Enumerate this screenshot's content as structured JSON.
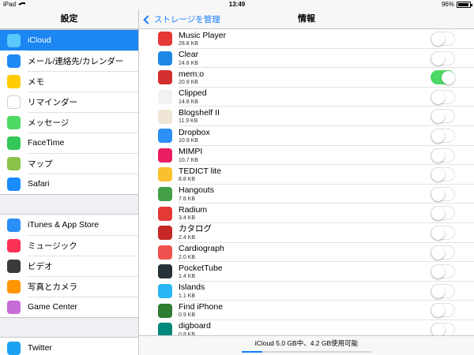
{
  "statusbar": {
    "device": "iPad",
    "time": "13:49",
    "battery": "96%",
    "battery_level": 0.96
  },
  "sidebar": {
    "title": "設定",
    "groups": [
      [
        {
          "label": "iCloud",
          "icon": "icloud-icon",
          "color": "#5ac8fa",
          "selected": true
        },
        {
          "label": "メール/連絡先/カレンダー",
          "icon": "mail-icon",
          "color": "#1e88f5"
        },
        {
          "label": "メモ",
          "icon": "notes-icon",
          "color": "#ffcc00"
        },
        {
          "label": "リマインダー",
          "icon": "reminders-icon",
          "color": "#ffffff"
        },
        {
          "label": "メッセージ",
          "icon": "messages-icon",
          "color": "#4cd964"
        },
        {
          "label": "FaceTime",
          "icon": "facetime-icon",
          "color": "#34c759"
        },
        {
          "label": "マップ",
          "icon": "maps-icon",
          "color": "#8bc34a"
        },
        {
          "label": "Safari",
          "icon": "safari-icon",
          "color": "#1a8cff"
        }
      ],
      [
        {
          "label": "iTunes & App Store",
          "icon": "app-store-icon",
          "color": "#2a8ef7"
        },
        {
          "label": "ミュージック",
          "icon": "music-icon",
          "color": "#fc3158"
        },
        {
          "label": "ビデオ",
          "icon": "video-icon",
          "color": "#3a3a3c"
        },
        {
          "label": "写真とカメラ",
          "icon": "photos-icon",
          "color": "#ff9500"
        },
        {
          "label": "Game Center",
          "icon": "game-center-icon",
          "color": "#c86dd7"
        }
      ],
      [
        {
          "label": "Twitter",
          "icon": "twitter-icon",
          "color": "#1da1f2"
        }
      ]
    ]
  },
  "nav": {
    "back_label": "ストレージを管理",
    "title": "情報"
  },
  "apps": [
    {
      "name": "Music Player",
      "size": "28.8 KB",
      "icon": "music-player-icon",
      "color": "#e53935",
      "on": false
    },
    {
      "name": "Clear",
      "size": "24.8 KB",
      "icon": "clear-icon",
      "color": "#1e88e5",
      "on": false
    },
    {
      "name": "mem:o",
      "size": "20.9 KB",
      "icon": "memo-icon",
      "color": "#d32f2f",
      "on": true
    },
    {
      "name": "Clipped",
      "size": "14.8 KB",
      "icon": "clipped-icon",
      "color": "#f2f2f2",
      "on": false
    },
    {
      "name": "Blogshelf II",
      "size": "11.9 KB",
      "icon": "blogshelf-icon",
      "color": "#efe6d6",
      "on": false
    },
    {
      "name": "Dropbox",
      "size": "10.9 KB",
      "icon": "dropbox-icon",
      "color": "#2b8ff5",
      "on": false
    },
    {
      "name": "MIMPI",
      "size": "10.7 KB",
      "icon": "mimpi-icon",
      "color": "#e91e63",
      "on": false
    },
    {
      "name": "TEDICT lite",
      "size": "8.8 KB",
      "icon": "tedict-icon",
      "color": "#fbc02d",
      "on": false
    },
    {
      "name": "Hangouts",
      "size": "7.8 KB",
      "icon": "hangouts-icon",
      "color": "#43a047",
      "on": false
    },
    {
      "name": "Radium",
      "size": "3.4 KB",
      "icon": "radium-icon",
      "color": "#e53935",
      "on": false
    },
    {
      "name": "カタログ",
      "size": "2.4 KB",
      "icon": "catalog-icon",
      "color": "#c62828",
      "on": false
    },
    {
      "name": "Cardiograph",
      "size": "2.0 KB",
      "icon": "cardiograph-icon",
      "color": "#ef5350",
      "on": false
    },
    {
      "name": "PocketTube",
      "size": "1.4 KB",
      "icon": "pockettube-icon",
      "color": "#263238",
      "on": false
    },
    {
      "name": "Islands",
      "size": "1.1 KB",
      "icon": "islands-icon",
      "color": "#29b6f6",
      "on": false
    },
    {
      "name": "Find iPhone",
      "size": "0.9 KB",
      "icon": "find-iphone-icon",
      "color": "#2e7d32",
      "on": false
    },
    {
      "name": "digboard",
      "size": "0.8 KB",
      "icon": "digboard-icon",
      "color": "#00897b",
      "on": false
    }
  ],
  "footer": {
    "text": "iCloud 5.0 GB中、4.2 GB使用可能",
    "used_fraction": 0.16
  }
}
